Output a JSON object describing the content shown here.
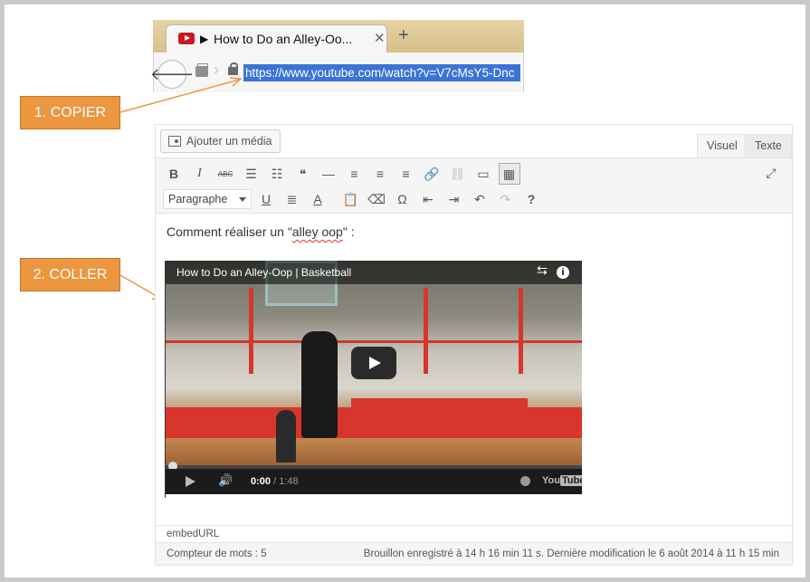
{
  "browser": {
    "tab_title": "How to Do an Alley-Oo...",
    "tab_play_glyph": "▶",
    "tab_close": "✕",
    "new_tab": "+",
    "back_glyph": "🡐",
    "url": "https://www.youtube.com/watch?v=V7cMsY5-Dnc"
  },
  "callouts": {
    "copy": "1. COPIER",
    "paste": "2. COLLER"
  },
  "editor": {
    "add_media": "Ajouter un média",
    "tab_visual": "Visuel",
    "tab_text": "Texte",
    "format_select": "Paragraphe",
    "paragraph_prefix": "Comment réaliser un \"",
    "paragraph_term": "alley oop",
    "paragraph_suffix": "\" :",
    "path": "embedURL",
    "word_count": "Compteur de mots : 5",
    "saved_status": "Brouillon enregistré à 14 h 16 min 11 s. Dernière modification le 6 août 2014 à 11 h 15 min"
  },
  "toolbar_row1": [
    {
      "icon": "bold-icon",
      "glyph": "B"
    },
    {
      "icon": "italic-icon",
      "glyph": "I"
    },
    {
      "icon": "strikethrough-icon",
      "glyph": "ABC"
    },
    {
      "icon": "bullet-list-icon",
      "glyph": "☰"
    },
    {
      "icon": "numbered-list-icon",
      "glyph": "☷"
    },
    {
      "icon": "blockquote-icon",
      "glyph": "❝"
    },
    {
      "icon": "horizontal-line-icon",
      "glyph": "—"
    },
    {
      "icon": "align-left-icon",
      "glyph": "≡"
    },
    {
      "icon": "align-center-icon",
      "glyph": "≡"
    },
    {
      "icon": "align-right-icon",
      "glyph": "≡"
    },
    {
      "icon": "link-icon",
      "glyph": "🔗"
    },
    {
      "icon": "unlink-icon",
      "glyph": "⛓"
    },
    {
      "icon": "read-more-icon",
      "glyph": "▭"
    },
    {
      "icon": "toolbar-toggle-icon",
      "glyph": "▦"
    }
  ],
  "toolbar_row2": [
    {
      "icon": "underline-icon",
      "glyph": "U"
    },
    {
      "icon": "justify-icon",
      "glyph": "≣"
    },
    {
      "icon": "text-color-icon",
      "glyph": "A"
    },
    {
      "icon": "paste-as-text-icon",
      "glyph": "📋"
    },
    {
      "icon": "clear-formatting-icon",
      "glyph": "⌫"
    },
    {
      "icon": "special-character-icon",
      "glyph": "Ω"
    },
    {
      "icon": "outdent-icon",
      "glyph": "⇤"
    },
    {
      "icon": "indent-icon",
      "glyph": "⇥"
    },
    {
      "icon": "undo-icon",
      "glyph": "↶"
    },
    {
      "icon": "redo-icon",
      "glyph": "↷"
    },
    {
      "icon": "help-icon",
      "glyph": "?"
    }
  ],
  "fullscreen_glyph": "⤢",
  "video": {
    "title": "How to Do an Alley-Oop | Basketball",
    "share_glyph": "<",
    "info_glyph": "i",
    "time_current": "0:00",
    "time_sep": " / ",
    "time_total": "1:48",
    "logo_you": "You",
    "logo_tube": "Tube",
    "volume_glyph": "🔊",
    "progress": 0
  },
  "colors": {
    "callout": "#ec9640",
    "url_highlight": "#3b74d6",
    "youtube_red": "#cc181e"
  }
}
